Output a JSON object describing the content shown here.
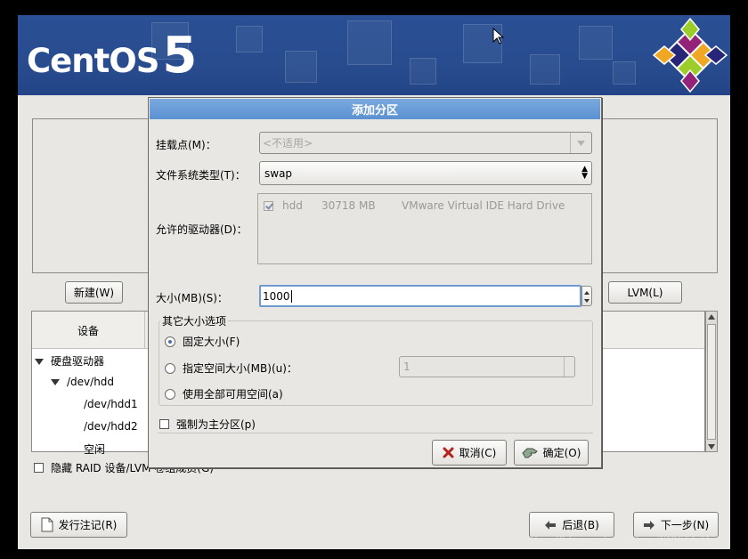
{
  "banner": {
    "logo_word": "CentOS",
    "logo_number": "5"
  },
  "main": {
    "new_button": "新建(W)",
    "new_button_key": "W",
    "lvm_button": "LVM(L)",
    "lvm_button_key": "L",
    "tree": {
      "column_device": "设备",
      "rows": [
        {
          "label": "硬盘驱动器",
          "expanded": true
        },
        {
          "label": "/dev/hdd",
          "expanded": true
        },
        {
          "label": "/dev/hdd1"
        },
        {
          "label": "/dev/hdd2"
        },
        {
          "label": "空闲"
        }
      ]
    },
    "hide_raid_label": "隐藏 RAID 设备/LVM 卷组成员(G)",
    "release_notes_button": "发行注记(R)",
    "back_button": "后退(B)",
    "next_button": "下一步(N)"
  },
  "dialog": {
    "title": "添加分区",
    "mount_label": "挂载点(M)：",
    "mount_value": "<不适用>",
    "fs_label": "文件系统类型(T)：",
    "fs_value": "swap",
    "drives_label": "允许的驱动器(D)：",
    "drive": {
      "name": "hdd",
      "size": "30718 MB",
      "model": "VMware Virtual IDE Hard Drive",
      "checked": true
    },
    "size_label": "大小(MB)(S)：",
    "size_value": "1000",
    "size_options_title": "其它大小选项",
    "option_fixed": "固定大小(F)",
    "option_max": "指定空间大小(MB)(u)：",
    "option_max_value": "1",
    "option_fill": "使用全部可用空间(a)",
    "selected_option": "fixed",
    "primary_label": "强制为主分区(p)",
    "primary_checked": false,
    "cancel_button": "取消(C)",
    "ok_button": "确定(O)"
  },
  "watermark": "https://blog.csdn.net/qq_32066631",
  "colors": {
    "banner": "#284c8e",
    "dialog_title": "#6a9dd8",
    "window_bg": "#e8e7e3"
  }
}
